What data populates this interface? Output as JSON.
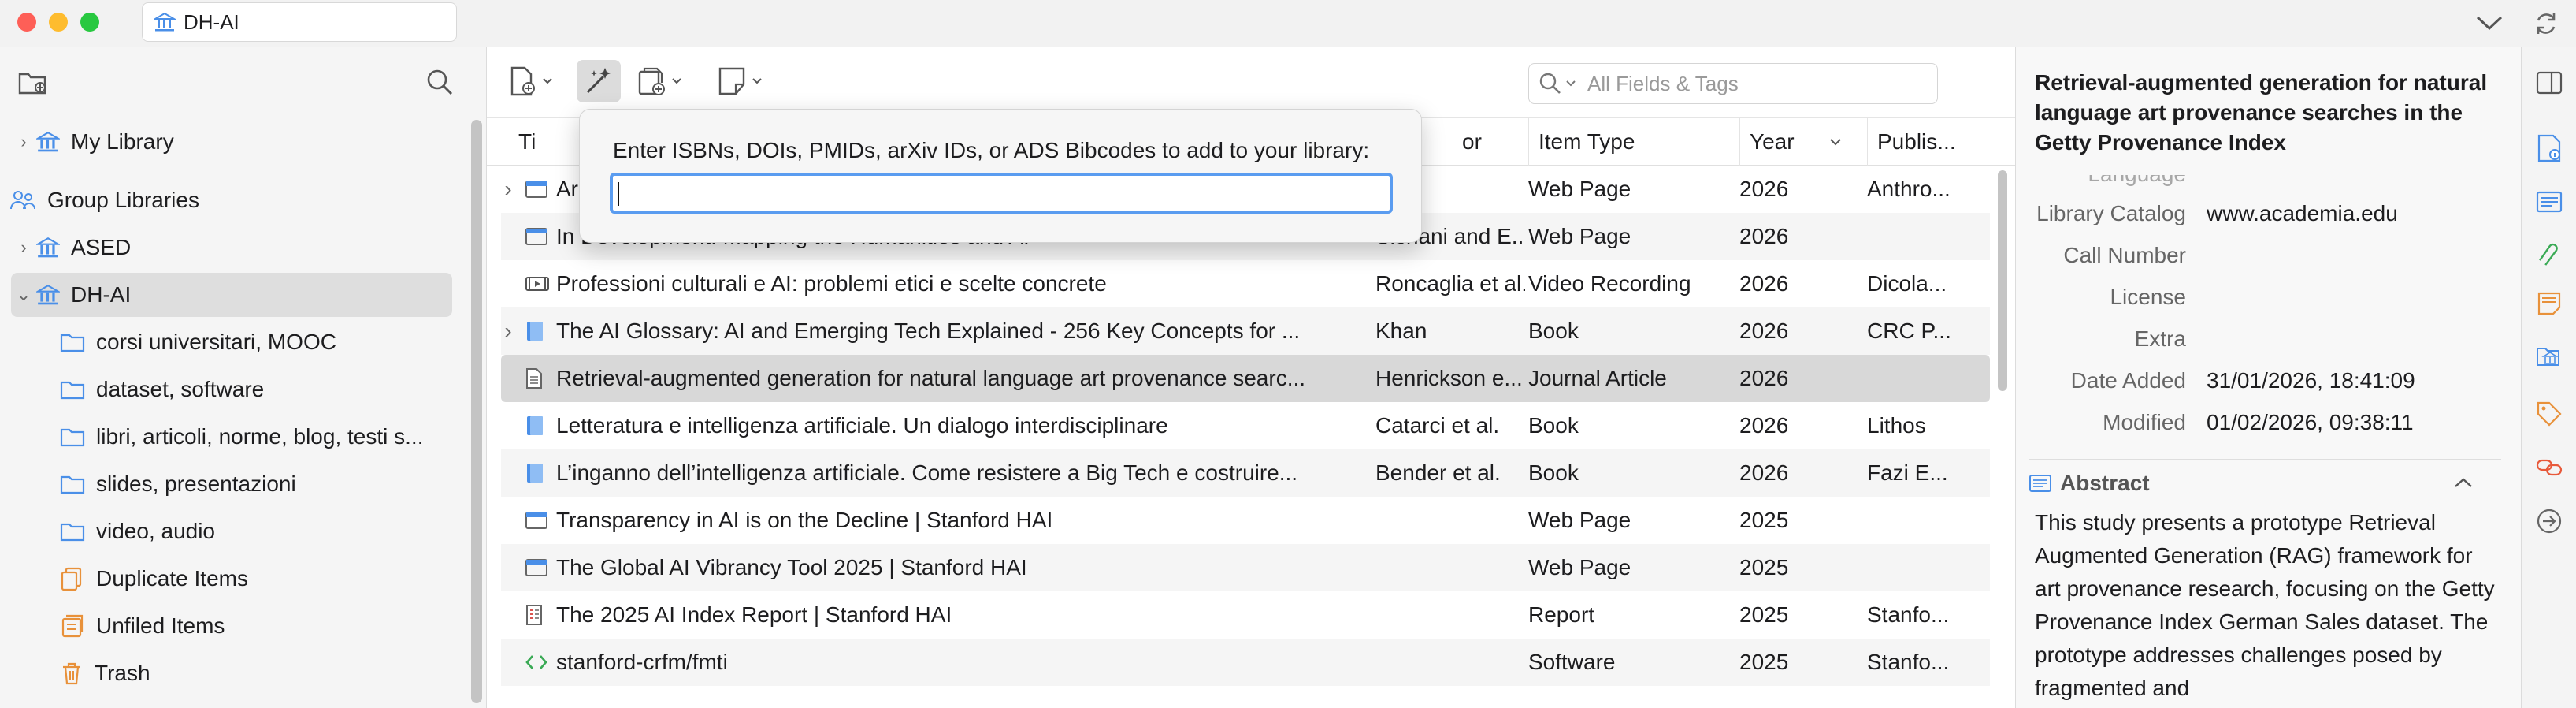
{
  "window": {
    "tab_title": "DH-AI"
  },
  "sidebar": {
    "tree": [
      {
        "label": "My Library",
        "expander": "›"
      },
      {
        "label": "Group Libraries",
        "expander": ""
      },
      {
        "label": "ASED",
        "expander": "›"
      },
      {
        "label": "DH-AI",
        "expander": "⌄"
      },
      {
        "label": "corsi universitari, MOOC"
      },
      {
        "label": "dataset, software"
      },
      {
        "label": "libri, articoli, norme, blog, testi s..."
      },
      {
        "label": "slides, presentazioni"
      },
      {
        "label": "video, audio"
      },
      {
        "label": "Duplicate Items"
      },
      {
        "label": "Unfiled Items"
      },
      {
        "label": "Trash"
      }
    ]
  },
  "search": {
    "placeholder": "All Fields & Tags"
  },
  "columns": {
    "title": "Ti",
    "creator": "or",
    "item_type": "Item Type",
    "year": "Year",
    "publisher": "Publis..."
  },
  "popup": {
    "label": "Enter ISBNs, DOIs, PMIDs, arXiv IDs, or ADS Bibcodes to add to your library:",
    "value": ""
  },
  "items": [
    {
      "title": "Ar",
      "creator": "",
      "type": "Web Page",
      "year": "2026",
      "publisher": "Anthro...",
      "expand": "›"
    },
    {
      "title": "In Development: Mapping the Humanities and AI",
      "creator": "Sichani and E...",
      "type": "Web Page",
      "year": "2026",
      "publisher": ""
    },
    {
      "title": "Professioni culturali e AI: problemi etici e scelte concrete",
      "creator": "Roncaglia et al.",
      "type": "Video Recording",
      "year": "2026",
      "publisher": "Dicola..."
    },
    {
      "title": "The AI Glossary: AI and Emerging Tech Explained - 256 Key Concepts for ...",
      "creator": "Khan",
      "type": "Book",
      "year": "2026",
      "publisher": "CRC P...",
      "expand": "›"
    },
    {
      "title": "Retrieval-augmented generation for natural language art provenance searc...",
      "creator": "Henrickson e...",
      "type": "Journal Article",
      "year": "2026",
      "publisher": ""
    },
    {
      "title": "Letteratura e intelligenza artificiale. Un dialogo interdisciplinare",
      "creator": "Catarci et al.",
      "type": "Book",
      "year": "2026",
      "publisher": "Lithos"
    },
    {
      "title": "L’inganno dell’intelligenza artificiale. Come resistere a Big Tech e costruire...",
      "creator": "Bender et al.",
      "type": "Book",
      "year": "2026",
      "publisher": "Fazi E..."
    },
    {
      "title": "Transparency in AI is on the Decline | Stanford HAI",
      "creator": "",
      "type": "Web Page",
      "year": "2025",
      "publisher": ""
    },
    {
      "title": "The Global AI Vibrancy Tool 2025 | Stanford HAI",
      "creator": "",
      "type": "Web Page",
      "year": "2025",
      "publisher": ""
    },
    {
      "title": "The 2025 AI Index Report | Stanford HAI",
      "creator": "",
      "type": "Report",
      "year": "2025",
      "publisher": "Stanfo..."
    },
    {
      "title": "stanford-crfm/fmti",
      "creator": "",
      "type": "Software",
      "year": "2025",
      "publisher": "Stanfo..."
    }
  ],
  "details": {
    "title": "Retrieval-augmented generation for natural language art provenance searches in the Getty Provenance Index",
    "fields": [
      {
        "label": "Language",
        "value": ""
      },
      {
        "label": "Library Catalog",
        "value": "www.academia.edu"
      },
      {
        "label": "Call Number",
        "value": ""
      },
      {
        "label": "License",
        "value": ""
      },
      {
        "label": "Extra",
        "value": ""
      },
      {
        "label": "Date Added",
        "value": "31/01/2026, 18:41:09"
      },
      {
        "label": "Modified",
        "value": "01/02/2026, 09:38:11"
      }
    ],
    "abstract_heading": "Abstract",
    "abstract": "This study presents a prototype Retrieval Augmented Generation (RAG) framework for art provenance research, focusing on the Getty Provenance Index German Sales dataset. The prototype addresses challenges posed by fragmented and"
  },
  "colors": {
    "accent": "#4a8fe8",
    "folder": "#4a8fe8",
    "selected_row": "#d8d8d8",
    "orange": "#e8913a"
  }
}
